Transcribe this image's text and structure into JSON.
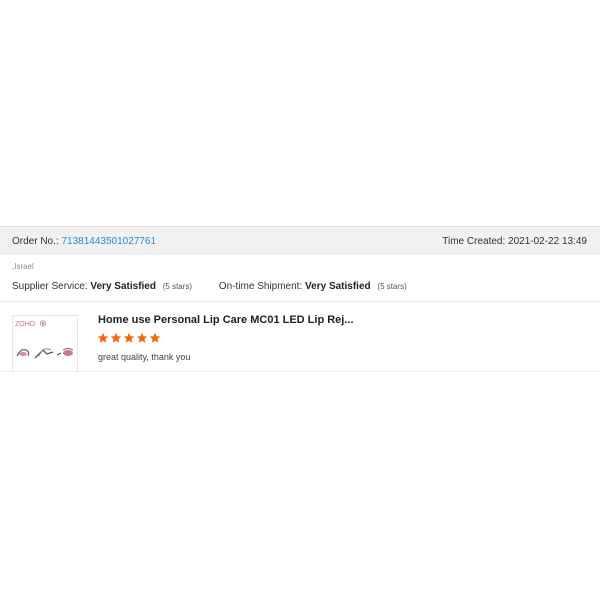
{
  "order": {
    "label": "Order No.:",
    "number": "71381443501027761",
    "time_label": "Time Created:",
    "time_value": "2021-02-22 13:49"
  },
  "buyer": {
    "country": "Israel"
  },
  "ratings": {
    "supplier_label": "Supplier Service:",
    "supplier_value": "Very Satisfied",
    "supplier_stars": "(5 stars)",
    "shipment_label": "On-time Shipment:",
    "shipment_value": "Very Satisfied",
    "shipment_stars": "(5 stars)"
  },
  "review": {
    "product_title": "Home use Personal Lip Care MC01 LED Lip Rej...",
    "rating": 5,
    "rating_max": 5,
    "comment": "great quality, thank you",
    "thumb_brand": "ZOHO"
  },
  "colors": {
    "link": "#2a8ad7",
    "star": "#f06a0f",
    "order_bar_bg": "#f1f1f1"
  }
}
